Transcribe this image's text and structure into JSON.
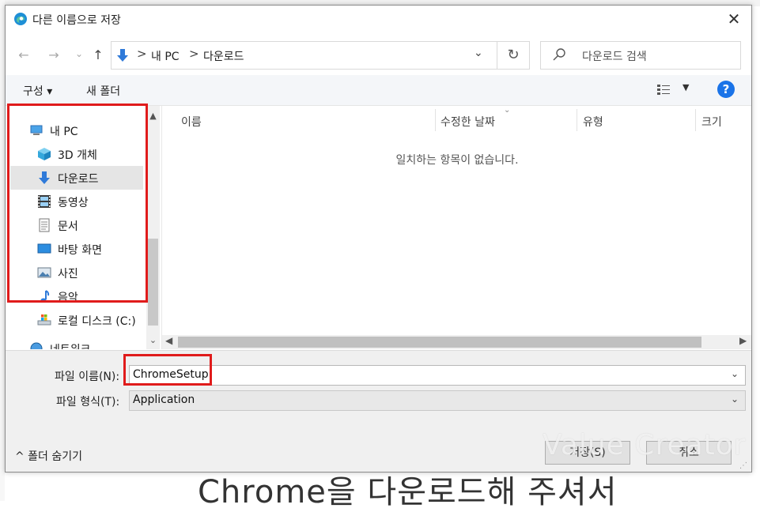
{
  "window": {
    "title": "다른 이름으로 저장",
    "close_glyph": "✕"
  },
  "background": {
    "caption": "Chrome을 다운로드해 주셔서"
  },
  "nav": {
    "back_glyph": "←",
    "forward_glyph": "→",
    "recent_glyph": "⌄",
    "up_glyph": "↑",
    "breadcrumb": [
      "내 PC",
      "다운로드"
    ],
    "separator": ">",
    "refresh_glyph": "↻",
    "search_placeholder": "다운로드 검색"
  },
  "toolbar": {
    "organize_label": "구성 ▾",
    "new_folder_label": "새 폴더",
    "help_label": "?"
  },
  "sidebar": {
    "items": [
      {
        "label": "내 PC",
        "icon": "computer-icon"
      },
      {
        "label": "3D 개체",
        "icon": "cube-icon"
      },
      {
        "label": "다운로드",
        "icon": "download-arrow-icon",
        "selected": true
      },
      {
        "label": "동영상",
        "icon": "film-icon"
      },
      {
        "label": "문서",
        "icon": "document-icon"
      },
      {
        "label": "바탕 화면",
        "icon": "desktop-icon"
      },
      {
        "label": "사진",
        "icon": "picture-icon"
      },
      {
        "label": "음악",
        "icon": "music-note-icon"
      },
      {
        "label": "로컬 디스크 (C:)",
        "icon": "drive-icon"
      },
      {
        "label": "네트워크",
        "icon": "network-icon"
      }
    ]
  },
  "file_list": {
    "columns": [
      "이름",
      "수정한 날짜",
      "유형",
      "크기"
    ],
    "empty_message": "일치하는 항목이 없습니다."
  },
  "form": {
    "filename_label": "파일 이름(N):",
    "filename_value": "ChromeSetup",
    "filetype_label": "파일 형식(T):",
    "filetype_value": "Application"
  },
  "footer": {
    "hide_folders_label": "^  폴더 숨기기",
    "save_label": "저장(S)",
    "cancel_label": "취소"
  },
  "watermark": "Value Creator",
  "colors": {
    "accent": "#1a73e8",
    "highlight_red": "#e01b1b",
    "selected_bg": "#e5e5e5"
  }
}
